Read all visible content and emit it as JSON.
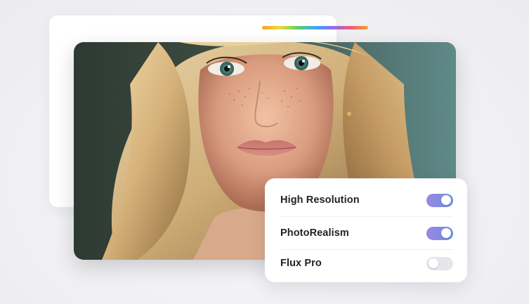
{
  "accent_gradient": [
    "#f9a02a",
    "#f4d834",
    "#5fcf6a",
    "#3ea9ee",
    "#8c6ff0",
    "#f05a7a",
    "#f9a02a"
  ],
  "toggle_on_gradient": [
    "#9a88df",
    "#6d8ee6"
  ],
  "preview": {
    "image": "portrait-photo"
  },
  "settings": [
    {
      "label": "High Resolution",
      "enabled": true
    },
    {
      "label": "PhotoRealism",
      "enabled": true
    },
    {
      "label": "Flux Pro",
      "enabled": false
    }
  ]
}
